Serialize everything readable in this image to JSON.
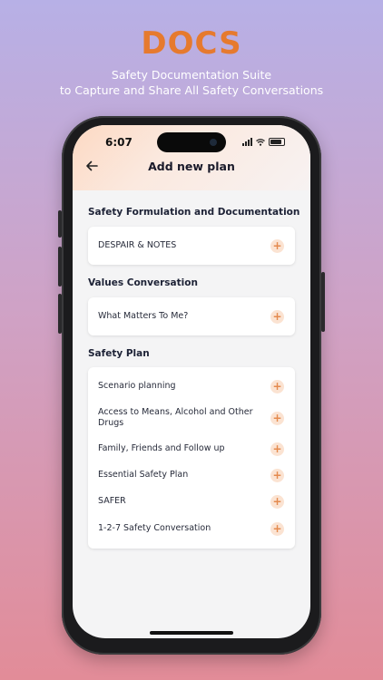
{
  "brand": "DOCS",
  "tagline": [
    "Safety Documentation Suite",
    "to Capture and Share All Safety Conversations"
  ],
  "status_bar": {
    "time": "6:07"
  },
  "nav": {
    "title": "Add new plan",
    "back_icon": "arrow-left-icon"
  },
  "sections": [
    {
      "title": "Safety Formulation and Documentation",
      "items": [
        "DESPAIR & NOTES"
      ]
    },
    {
      "title": "Values Conversation",
      "items": [
        "What Matters To Me?"
      ]
    },
    {
      "title": "Safety Plan",
      "items": [
        "Scenario planning",
        "Access to Means, Alcohol and Other Drugs",
        "Family, Friends and Follow up",
        "Essential Safety Plan",
        "SAFER",
        "1-2-7 Safety Conversation"
      ]
    }
  ],
  "plus_glyph": "+",
  "colors": {
    "accent": "#e67a2e",
    "plus_bg": "#fbe3d2",
    "plus_fg": "#e48a4e"
  }
}
